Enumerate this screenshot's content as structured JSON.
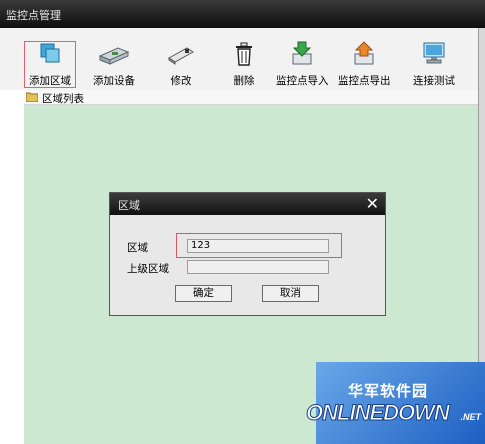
{
  "window": {
    "title": "监控点管理"
  },
  "toolbar": {
    "items": [
      {
        "label": "添加区域",
        "icon": "add-area-icon"
      },
      {
        "label": "添加设备",
        "icon": "add-device-icon"
      },
      {
        "label": "修改",
        "icon": "edit-icon"
      },
      {
        "label": "删除",
        "icon": "trash-icon"
      },
      {
        "label": "监控点导入",
        "icon": "import-icon"
      },
      {
        "label": "监控点导出",
        "icon": "export-icon"
      },
      {
        "label": "连接测试",
        "icon": "connection-test-icon"
      }
    ],
    "selected_index": 0
  },
  "tree": {
    "header_label": "区域列表",
    "icon": "folder-icon"
  },
  "dialog": {
    "title": "区域",
    "close_glyph": "✕",
    "area_label": "区域",
    "area_value": "123",
    "parent_label": "上级区域",
    "parent_value": "",
    "ok_label": "确定",
    "cancel_label": "取消"
  },
  "watermark": {
    "cn_text": "华军软件园",
    "en_text": "ONLINEDOWN",
    "domain_text": ".NET"
  },
  "colors": {
    "content_bg": "#cce8d0",
    "highlight": "#d65a68",
    "titlebar": "#1a1a1a"
  }
}
